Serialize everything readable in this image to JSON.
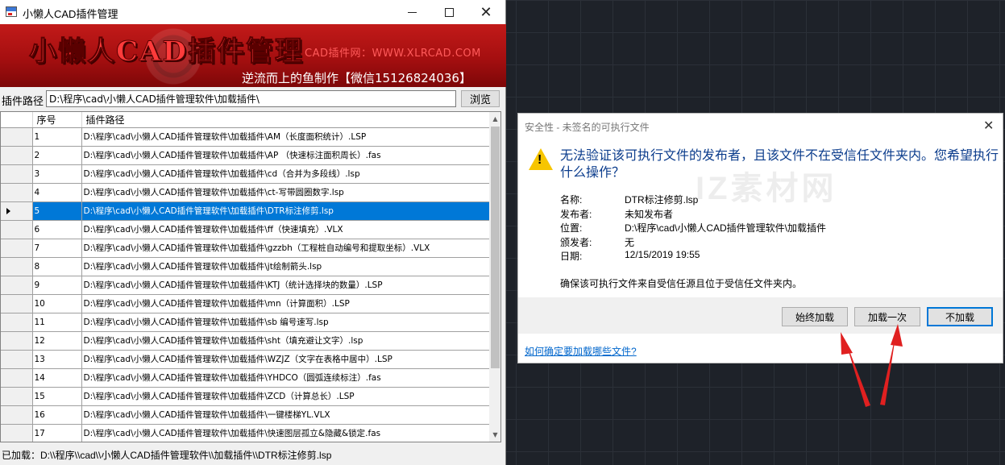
{
  "plugin_window": {
    "title": "小懒人CAD插件管理",
    "banner": {
      "title": "小懒人CAD插件管理",
      "site": "CAD插件网：WWW.XLRCAD.COM",
      "author": "逆流而上的鱼制作【微信15126824036】"
    },
    "path_label": "插件路径",
    "path_value": "D:\\程序\\cad\\小懒人CAD插件管理软件\\加载插件\\",
    "browse_label": "浏览",
    "table": {
      "headers": [
        "序号",
        "插件路径"
      ],
      "selected_row": 5,
      "rows": [
        {
          "num": "1",
          "path": "D:\\程序\\cad\\小懒人CAD插件管理软件\\加载插件\\AM（长度面积统计）.LSP"
        },
        {
          "num": "2",
          "path": "D:\\程序\\cad\\小懒人CAD插件管理软件\\加载插件\\AP （快速标注面积周长）.fas"
        },
        {
          "num": "3",
          "path": "D:\\程序\\cad\\小懒人CAD插件管理软件\\加载插件\\cd（合并为多段线）.lsp"
        },
        {
          "num": "4",
          "path": "D:\\程序\\cad\\小懒人CAD插件管理软件\\加载插件\\ct-写带圆圈数字.lsp"
        },
        {
          "num": "5",
          "path": "D:\\程序\\cad\\小懒人CAD插件管理软件\\加载插件\\DTR标注修剪.lsp"
        },
        {
          "num": "6",
          "path": "D:\\程序\\cad\\小懒人CAD插件管理软件\\加载插件\\ff（快速填充）.VLX"
        },
        {
          "num": "7",
          "path": "D:\\程序\\cad\\小懒人CAD插件管理软件\\加载插件\\gzzbh（工程桩自动编号和提取坐标）.VLX"
        },
        {
          "num": "8",
          "path": "D:\\程序\\cad\\小懒人CAD插件管理软件\\加载插件\\jt绘制箭头.lsp"
        },
        {
          "num": "9",
          "path": "D:\\程序\\cad\\小懒人CAD插件管理软件\\加载插件\\KTJ（统计选择块的数量）.LSP"
        },
        {
          "num": "10",
          "path": "D:\\程序\\cad\\小懒人CAD插件管理软件\\加载插件\\mn（计算面积）.LSP"
        },
        {
          "num": "11",
          "path": "D:\\程序\\cad\\小懒人CAD插件管理软件\\加载插件\\sb 编号速写.lsp"
        },
        {
          "num": "12",
          "path": "D:\\程序\\cad\\小懒人CAD插件管理软件\\加载插件\\sht（填充避让文字）.lsp"
        },
        {
          "num": "13",
          "path": "D:\\程序\\cad\\小懒人CAD插件管理软件\\加载插件\\WZJZ（文字在表格中居中）.LSP"
        },
        {
          "num": "14",
          "path": "D:\\程序\\cad\\小懒人CAD插件管理软件\\加载插件\\YHDCO（圆弧连续标注）.fas"
        },
        {
          "num": "15",
          "path": "D:\\程序\\cad\\小懒人CAD插件管理软件\\加载插件\\ZCD（计算总长）.LSP"
        },
        {
          "num": "16",
          "path": "D:\\程序\\cad\\小懒人CAD插件管理软件\\加载插件\\一键楼梯YL.VLX"
        },
        {
          "num": "17",
          "path": "D:\\程序\\cad\\小懒人CAD插件管理软件\\加载插件\\快速图层孤立&隐藏&锁定.fas"
        }
      ]
    },
    "status": "已加载：D:\\\\程序\\\\cad\\\\小懒人CAD插件管理软件\\\\加载插件\\\\DTR标注修剪.lsp"
  },
  "security_dialog": {
    "title": "安全性 - 未签名的可执行文件",
    "heading": "无法验证该可执行文件的发布者，且该文件不在受信任文件夹内。您希望执行什么操作？",
    "info": [
      {
        "key": "名称:",
        "value": "DTR标注修剪.lsp"
      },
      {
        "key": "发布者:",
        "value": "未知发布者"
      },
      {
        "key": "位置:",
        "value": "D:\\程序\\cad\\小懒人CAD插件管理软件\\加载插件"
      },
      {
        "key": "颁发者:",
        "value": "无"
      },
      {
        "key": "日期:",
        "value": "12/15/2019  19:55"
      }
    ],
    "note": "确保该可执行文件来自受信任源且位于受信任文件夹内。",
    "buttons": {
      "always": "始终加载",
      "once": "加载一次",
      "noload": "不加载"
    },
    "link": "如何确定要加载哪些文件?",
    "watermark": "IZ素材网"
  },
  "colors": {
    "selection": "#0078d7",
    "banner_red": "#b01212",
    "annotation_arrow": "#e02020",
    "heading_blue": "#0b3c8c"
  }
}
